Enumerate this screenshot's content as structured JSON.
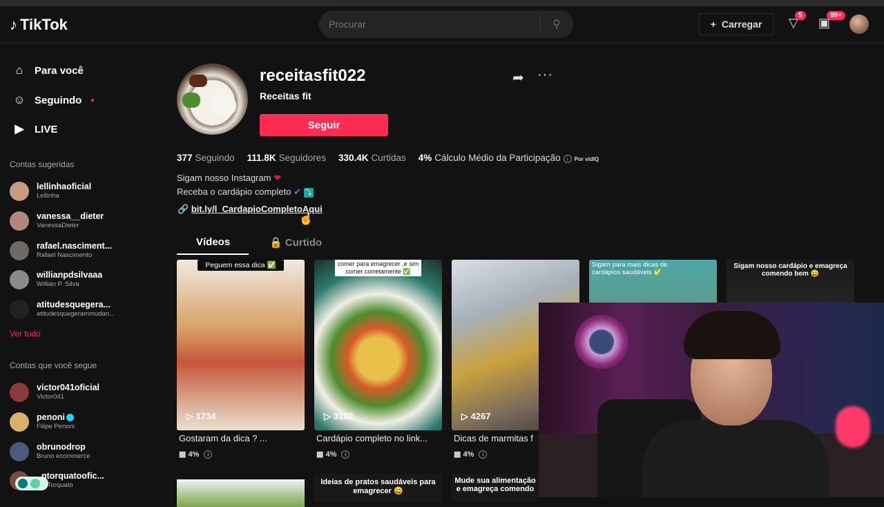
{
  "header": {
    "logo": "TikTok",
    "search_placeholder": "Procurar",
    "upload_label": "Carregar",
    "inbox_badge": "5",
    "messages_badge": "99+"
  },
  "sidebar": {
    "nav": [
      {
        "label": "Para você",
        "icon": "home-icon"
      },
      {
        "label": "Seguindo",
        "icon": "people-icon"
      },
      {
        "label": "LIVE",
        "icon": "live-icon"
      }
    ],
    "suggested_title": "Contas sugeridas",
    "suggested": [
      {
        "name": "lellinhaoficial",
        "sub": "Lellinha"
      },
      {
        "name": "vanessa__dieter",
        "sub": "VanessaDieter"
      },
      {
        "name": "rafael.nasciment...",
        "sub": "Rafael Nascimento"
      },
      {
        "name": "willianpdsilvaaa",
        "sub": "Willian P. Silva"
      },
      {
        "name": "atitudesquegera...",
        "sub": "atitudesquegerammudan..."
      }
    ],
    "see_all": "Ver tudo",
    "following_title": "Contas que você segue",
    "following": [
      {
        "name": "victor041oficial",
        "sub": "Victor041"
      },
      {
        "name": "penoni",
        "sub": "Filipe Penoni"
      },
      {
        "name": "obrunodrop",
        "sub": "Bruno ecommerce"
      },
      {
        "name": "..ntorquatoofic...",
        "sub": "...n Torquato"
      }
    ]
  },
  "profile": {
    "username": "receitasfit022",
    "display_name": "Receitas fit",
    "follow_label": "Seguir",
    "stats": {
      "following": "377",
      "following_label": "Seguindo",
      "followers": "111.8K",
      "followers_label": "Seguidores",
      "likes": "330.4K",
      "likes_label": "Curtidas",
      "engagement": "4%",
      "engagement_label": "Cálculo Médio da Participação",
      "vidiq": "Por vidIQ"
    },
    "bio_line1": "Sigam nosso Instagram",
    "bio_line2": "Receba o cardápio completo",
    "link": "bit.ly/l_CardapioCompletoAqui"
  },
  "tabs": {
    "videos": "Vídeos",
    "liked": "Curtido"
  },
  "videos": [
    {
      "top_caption": "Peguem essa dica ✅",
      "views": "1734",
      "caption": "Gostaram da dica ? ...",
      "engagement": "4%"
    },
    {
      "top_caption": "comer para emagrecer ,e sim comer corretamente ✅",
      "views": "3192",
      "caption": "Cardápio completo no link...",
      "engagement": "4%"
    },
    {
      "top_caption": "",
      "views": "4267",
      "caption": "Dicas de marmitas f",
      "engagement": "4%"
    },
    {
      "top_caption": "Sigam para mais dicas de cardápios saudáveis ✅",
      "views": "",
      "caption": "",
      "engagement": ""
    },
    {
      "top_caption": "Sigam nosso cardápio e emagreça comendo bem 😀",
      "views": "",
      "caption": "",
      "engagement": ""
    }
  ],
  "next_row": [
    "",
    "Ideias de pratos saudáveis para emagrecer 😀",
    "Mude sua alimentação e emagreça comendo"
  ],
  "colors": {
    "accent": "#fe2c55",
    "background": "#121212"
  }
}
